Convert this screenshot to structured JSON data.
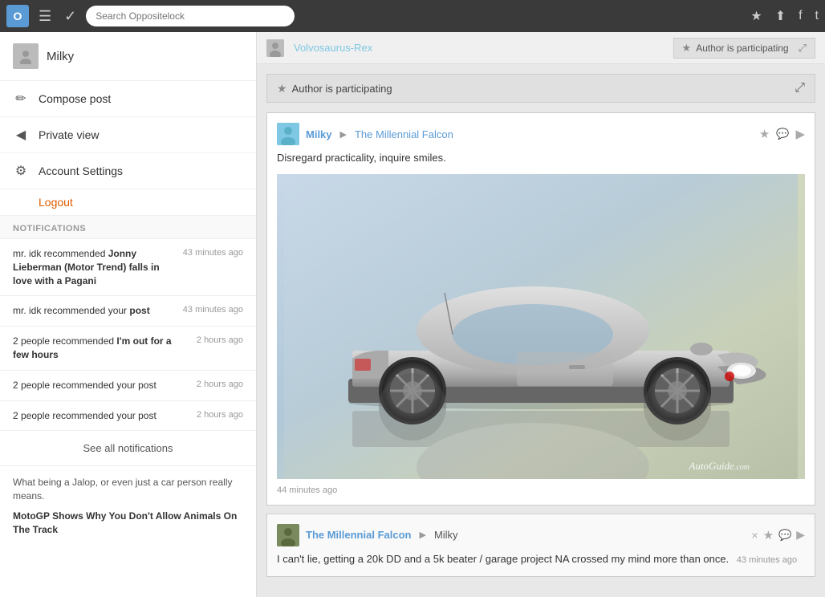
{
  "topbar": {
    "logo_label": "O",
    "search_placeholder": "Search Oppositelock",
    "brand_link": "The Millennial Falcon",
    "icons": {
      "hamburger": "☰",
      "check": "✓",
      "star": "★",
      "share": "⬆",
      "facebook": "f",
      "twitter": "t"
    }
  },
  "content_top_bar": {
    "user_link": "Volvosaurus-Rex"
  },
  "floating_panel": {
    "title": "Author is participating",
    "star_icon": "★",
    "expand_icon": "⤢",
    "close_icon": "×"
  },
  "author_bar": {
    "title": "Author is participating",
    "star_icon": "★",
    "expand_icon": "⤢"
  },
  "post": {
    "author": "Milky",
    "channel": "The Millennial Falcon",
    "text": "Disregard practicality, inquire smiles.",
    "timestamp": "44 minutes ago",
    "autoguide_watermark": "AutoGuide.com",
    "actions": {
      "star": "★",
      "bubble": "💬",
      "arrow": "▶"
    }
  },
  "reply": {
    "author": "The Millennial Falcon",
    "arrow": "▶",
    "to_user": "Milky",
    "text": "I can't lie, getting a 20k DD and a 5k beater / garage project NA crossed my mind more than once.",
    "timestamp": "43 minutes ago",
    "actions": {
      "close": "×",
      "star": "★",
      "bubble": "💬",
      "arrow": "▶"
    }
  },
  "sidebar": {
    "username": "Milky",
    "menu_items": [
      {
        "id": "compose",
        "icon": "✏",
        "label": "Compose post"
      },
      {
        "id": "private",
        "icon": "◀",
        "label": "Private view"
      },
      {
        "id": "settings",
        "icon": "⚙",
        "label": "Account Settings"
      }
    ],
    "logout_label": "Logout",
    "notifications_header": "NOTIFICATIONS",
    "notifications": [
      {
        "id": "n1",
        "prefix": "mr. idk recommended ",
        "bold": "Jonny Lieberman (Motor Trend) falls in love with a Pagani",
        "suffix": "",
        "time": "43 minutes ago"
      },
      {
        "id": "n2",
        "prefix": "mr. idk recommended your ",
        "bold": "post",
        "suffix": "",
        "time": "43 minutes ago"
      },
      {
        "id": "n3",
        "prefix": "2 people recommended ",
        "bold": "I'm out for a few hours",
        "suffix": "",
        "time": "2 hours ago"
      },
      {
        "id": "n4",
        "prefix": "2 people recommended your post",
        "bold": "",
        "suffix": "",
        "time": "2 hours ago"
      },
      {
        "id": "n5",
        "prefix": "2 people recommended your post",
        "bold": "",
        "suffix": "",
        "time": "2 hours ago"
      }
    ],
    "see_all": "See all notifications",
    "footer_links": [
      {
        "id": "fl1",
        "text": "What being a Jalop, or even just a car person really means.",
        "bold": false
      },
      {
        "id": "fl2",
        "text": "MotoGP Shows Why You Don't Allow Animals On The Track",
        "bold": true
      }
    ]
  }
}
